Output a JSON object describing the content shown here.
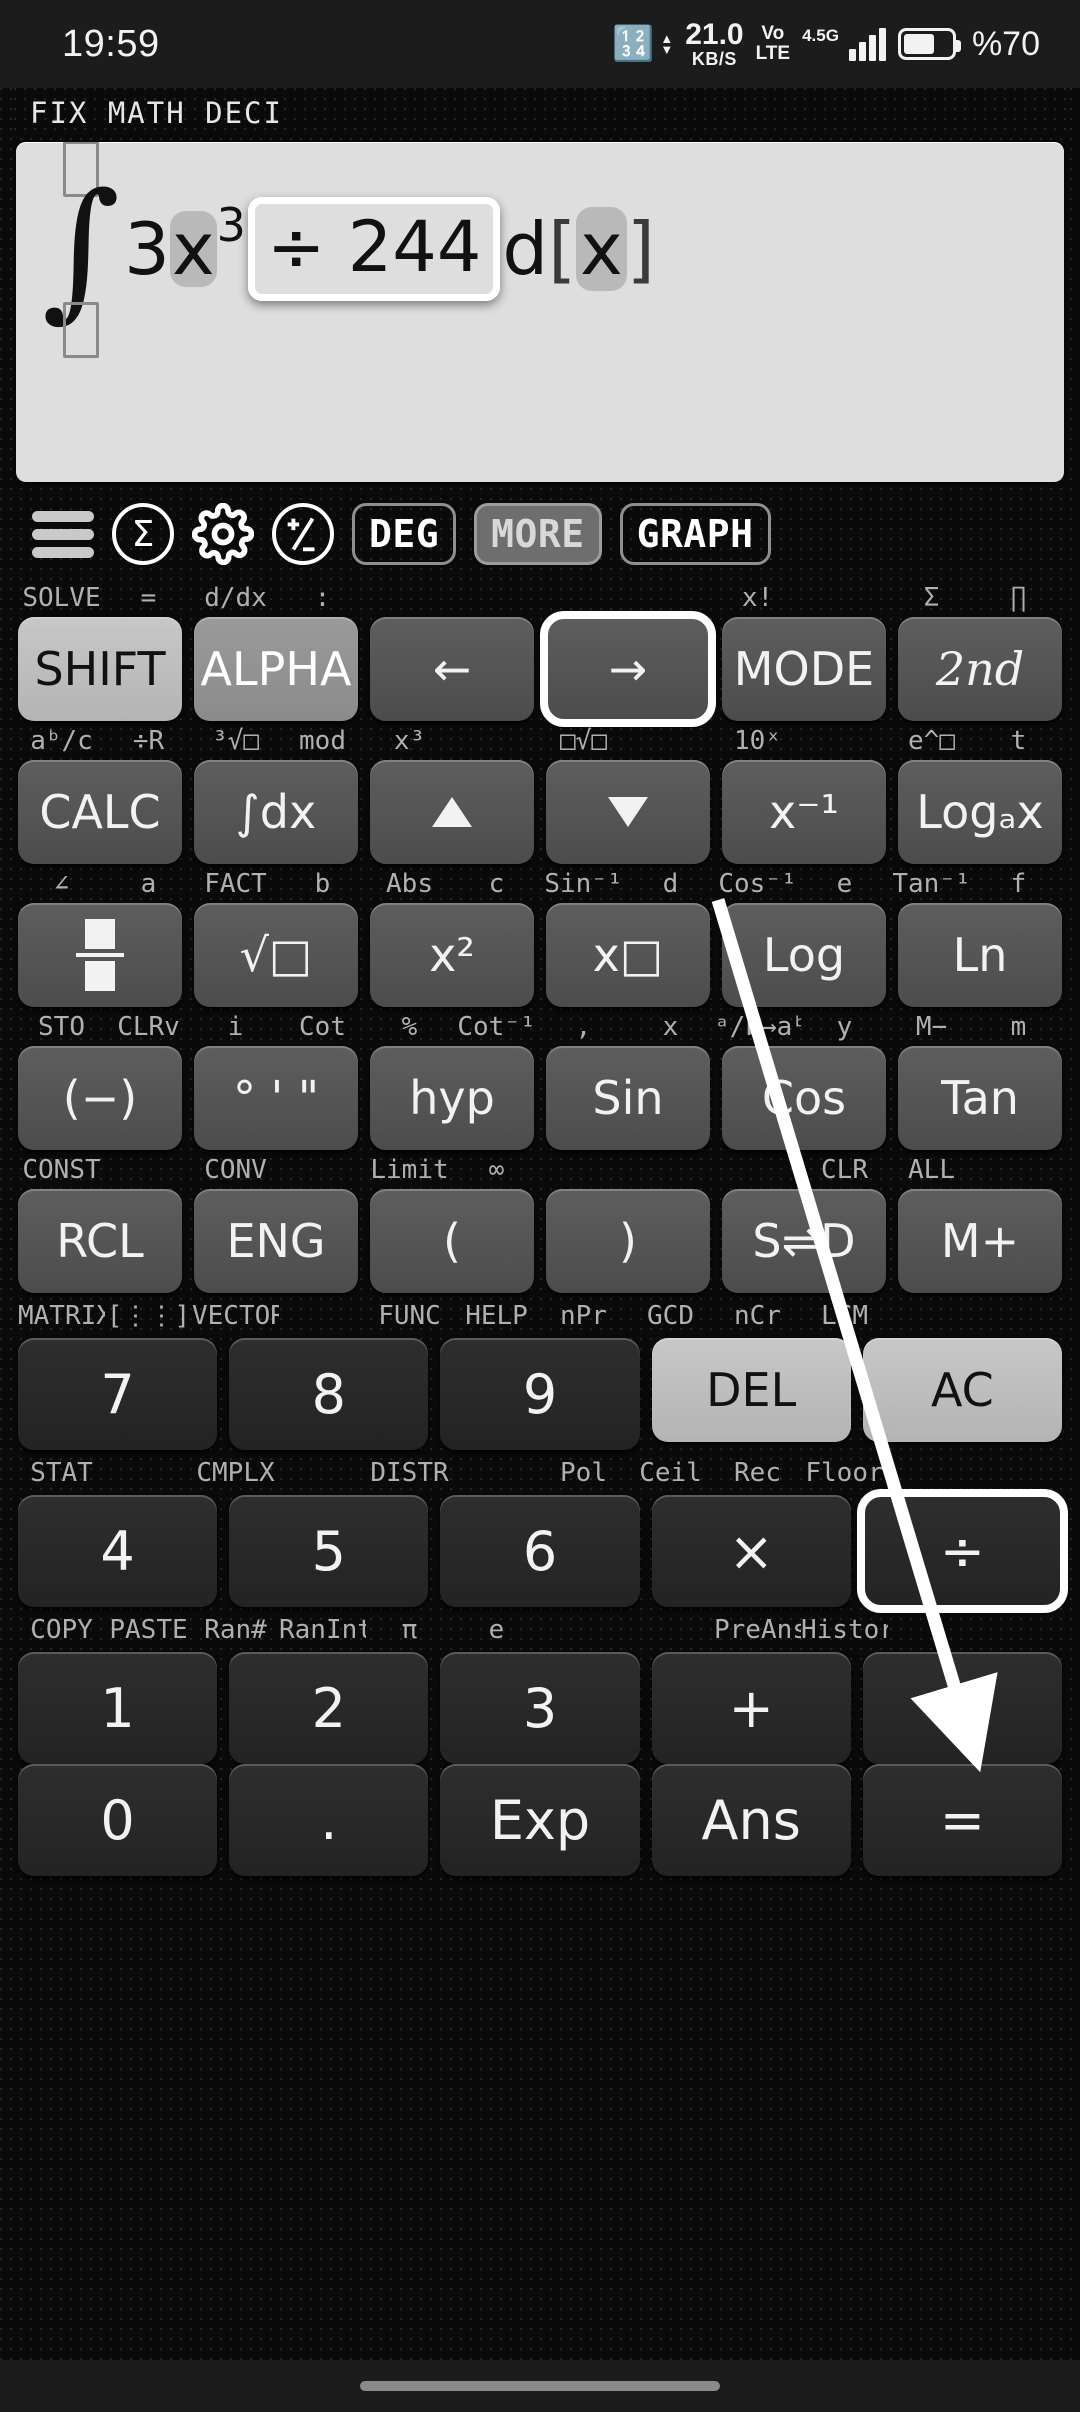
{
  "status_bar": {
    "clock": "19:59",
    "bluetooth_icon": "bluetooth-icon",
    "net_speed_value": "21.0",
    "net_speed_unit": "KB/S",
    "volte_top": "Vo",
    "volte_bottom": "LTE",
    "network_gen": "4.5G",
    "battery_percent": "%70"
  },
  "indicators": "FIX  MATH  DECI",
  "display": {
    "integral_glyph": "∫",
    "upper_limit_placeholder": "",
    "lower_limit_placeholder": "",
    "coefficient": "3",
    "variable": "x",
    "exponent": "3",
    "selected_token": "÷ 244",
    "differential": "d",
    "bracket_open": "[",
    "integration_var": "x",
    "bracket_close": "]",
    "expression_text": "∫ 3x^3 ÷ 244 d[x]"
  },
  "toolbar": {
    "menu_icon": "hamburger-menu-icon",
    "sigma_icon": "sigma-circle-icon",
    "settings_icon": "gear-icon",
    "plusminus_icon": "plus-minus-circle-icon",
    "angle_mode": "DEG",
    "more": "MORE",
    "graph": "GRAPH"
  },
  "keypad": {
    "rows": [
      {
        "labels": [
          "SOLVE",
          "=",
          "d/dx",
          ":",
          "",
          "",
          "",
          "",
          "x!",
          "",
          "Σ",
          "∏"
        ],
        "keys": [
          {
            "label": "SHIFT",
            "style": "light",
            "name": "shift"
          },
          {
            "label": "ALPHA",
            "style": "mid",
            "name": "alpha"
          },
          {
            "label": "←",
            "style": "fn",
            "name": "arrow-left"
          },
          {
            "label": "→",
            "style": "fn",
            "name": "arrow-right",
            "selected": true
          },
          {
            "label": "MODE",
            "style": "fn",
            "name": "mode"
          },
          {
            "label": "2nd",
            "style": "fn",
            "name": "second",
            "italic": true
          }
        ]
      },
      {
        "labels": [
          "aᵇ/c",
          "÷R",
          "³√□",
          "mod",
          "x³",
          "",
          "□√□",
          "",
          "10ˣ",
          "",
          "e^□",
          "t"
        ],
        "keys": [
          {
            "label": "CALC",
            "style": "fn",
            "name": "calc"
          },
          {
            "label": "∫dx",
            "style": "fn",
            "name": "integral-dx"
          },
          {
            "label": "▲",
            "style": "fn",
            "name": "arrow-up",
            "icon": "arrow-up"
          },
          {
            "label": "▼",
            "style": "fn",
            "name": "arrow-down",
            "icon": "arrow-down"
          },
          {
            "label": "x⁻¹",
            "style": "fn",
            "name": "reciprocal"
          },
          {
            "label": "Logₐx",
            "style": "fn",
            "name": "log-base-a"
          }
        ]
      },
      {
        "labels": [
          "∠",
          "a",
          "FACT",
          "b",
          "Abs",
          "c",
          "Sin⁻¹",
          "d",
          "Cos⁻¹",
          "e",
          "Tan⁻¹",
          "f"
        ],
        "keys": [
          {
            "label": "",
            "style": "fn",
            "name": "fraction",
            "icon": "fraction"
          },
          {
            "label": "√□",
            "style": "fn",
            "name": "square-root"
          },
          {
            "label": "x²",
            "style": "fn",
            "name": "square"
          },
          {
            "label": "x□",
            "style": "fn",
            "name": "power"
          },
          {
            "label": "Log",
            "style": "fn",
            "name": "log"
          },
          {
            "label": "Ln",
            "style": "fn",
            "name": "ln"
          }
        ]
      },
      {
        "labels": [
          "STO",
          "CLRv",
          "i",
          "Cot",
          "%",
          "Cot⁻¹",
          ",",
          "x",
          "ᵃ/b→aᵇ/c",
          "y",
          "M−",
          "m"
        ],
        "keys": [
          {
            "label": "(−)",
            "style": "fn",
            "name": "negative"
          },
          {
            "label": "° ' \"",
            "style": "fn",
            "name": "degrees-minutes-seconds"
          },
          {
            "label": "hyp",
            "style": "fn",
            "name": "hyperbolic"
          },
          {
            "label": "Sin",
            "style": "fn",
            "name": "sine"
          },
          {
            "label": "Cos",
            "style": "fn",
            "name": "cosine"
          },
          {
            "label": "Tan",
            "style": "fn",
            "name": "tangent"
          }
        ]
      },
      {
        "labels": [
          "CONST",
          "",
          "CONV",
          "",
          "Limit",
          "∞",
          "",
          "",
          "",
          "CLR",
          "ALL",
          ""
        ],
        "keys": [
          {
            "label": "RCL",
            "style": "fn",
            "name": "recall"
          },
          {
            "label": "ENG",
            "style": "fn",
            "name": "engineering"
          },
          {
            "label": "(",
            "style": "fn",
            "name": "paren-open"
          },
          {
            "label": ")",
            "style": "fn",
            "name": "paren-close"
          },
          {
            "label": "S⇌D",
            "style": "fn",
            "name": "std-dec-toggle"
          },
          {
            "label": "M+",
            "style": "fn",
            "name": "memory-plus"
          }
        ]
      },
      {
        "labels": [
          "MATRIX",
          "[⋮⋮]",
          "VECTOR",
          "",
          "FUNC",
          "HELP",
          "nPr",
          "GCD",
          "nCr",
          "LCM",
          "",
          ""
        ],
        "keys": [
          {
            "label": "7",
            "style": "num",
            "name": "digit-7"
          },
          {
            "label": "8",
            "style": "num",
            "name": "digit-8"
          },
          {
            "label": "9",
            "style": "num",
            "name": "digit-9"
          },
          {
            "label": "DEL",
            "style": "light",
            "name": "delete"
          },
          {
            "label": "AC",
            "style": "light",
            "name": "all-clear"
          }
        ]
      },
      {
        "labels": [
          "STAT",
          "",
          "CMPLX",
          "",
          "DISTR",
          "",
          "Pol",
          "Ceil",
          "Rec",
          "Floor",
          "",
          ""
        ],
        "keys": [
          {
            "label": "4",
            "style": "num",
            "name": "digit-4"
          },
          {
            "label": "5",
            "style": "num",
            "name": "digit-5"
          },
          {
            "label": "6",
            "style": "num",
            "name": "digit-6"
          },
          {
            "label": "×",
            "style": "num",
            "name": "multiply"
          },
          {
            "label": "÷",
            "style": "num",
            "name": "divide",
            "selected": true
          }
        ]
      },
      {
        "labels": [
          "COPY",
          "PASTE",
          "Ran#",
          "RanInt",
          "π",
          "e",
          "",
          "",
          "PreAns",
          "History",
          "",
          ""
        ],
        "keys": [
          {
            "label": "1",
            "style": "num",
            "name": "digit-1"
          },
          {
            "label": "2",
            "style": "num",
            "name": "digit-2"
          },
          {
            "label": "3",
            "style": "num",
            "name": "digit-3"
          },
          {
            "label": "+",
            "style": "num",
            "name": "plus"
          },
          {
            "label": "−",
            "style": "num",
            "name": "minus"
          }
        ]
      },
      {
        "labels": [],
        "keys": [
          {
            "label": "0",
            "style": "num",
            "name": "digit-0"
          },
          {
            "label": ".",
            "style": "num",
            "name": "decimal-point"
          },
          {
            "label": "Exp",
            "style": "num",
            "name": "exponent"
          },
          {
            "label": "Ans",
            "style": "num",
            "name": "answer"
          },
          {
            "label": "=",
            "style": "num",
            "name": "equals"
          }
        ]
      }
    ]
  },
  "nav_bar": {
    "home_indicator": "home-indicator"
  },
  "colors": {
    "background": "#0a0a0a",
    "display_bg": "#dedede",
    "key_fn": "#5a5a5a",
    "key_num": "#2a2a2a",
    "key_light": "#bfbfbf",
    "highlight": "#ffffff"
  }
}
